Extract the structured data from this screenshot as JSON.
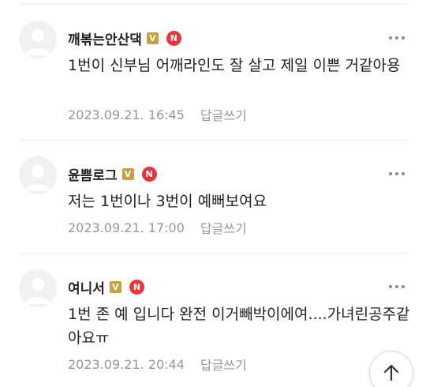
{
  "comments": [
    {
      "nickname": "깨볶는안산댁",
      "v_badge": "V",
      "n_badge": "N",
      "text": "1번이 신부님 어깨라인도 잘 살고 제일 이쁜 거같아용",
      "date": "2023.09.21. 16:45",
      "reply_label": "답글쓰기"
    },
    {
      "nickname": "윤쁨로그",
      "v_badge": "V",
      "n_badge": "N",
      "text": "저는 1번이나 3번이 예뻐보여요",
      "date": "2023.09.21. 17:00",
      "reply_label": "답글쓰기"
    },
    {
      "nickname": "여니서",
      "v_badge": "V",
      "n_badge": "N",
      "text": "1번 존 예 입니다 완전 이거빼박이에여....가녀린공주같아요ㅠ",
      "date": "2023.09.21. 20:44",
      "reply_label": "답글쓰기"
    }
  ],
  "colors": {
    "v_badge": "#c9a13a",
    "n_badge": "#e8343b",
    "meta_text": "#979797"
  },
  "icons": {
    "avatar": "default-profile-icon",
    "more": "more-dots-icon",
    "scroll_top": "arrow-up-icon"
  }
}
